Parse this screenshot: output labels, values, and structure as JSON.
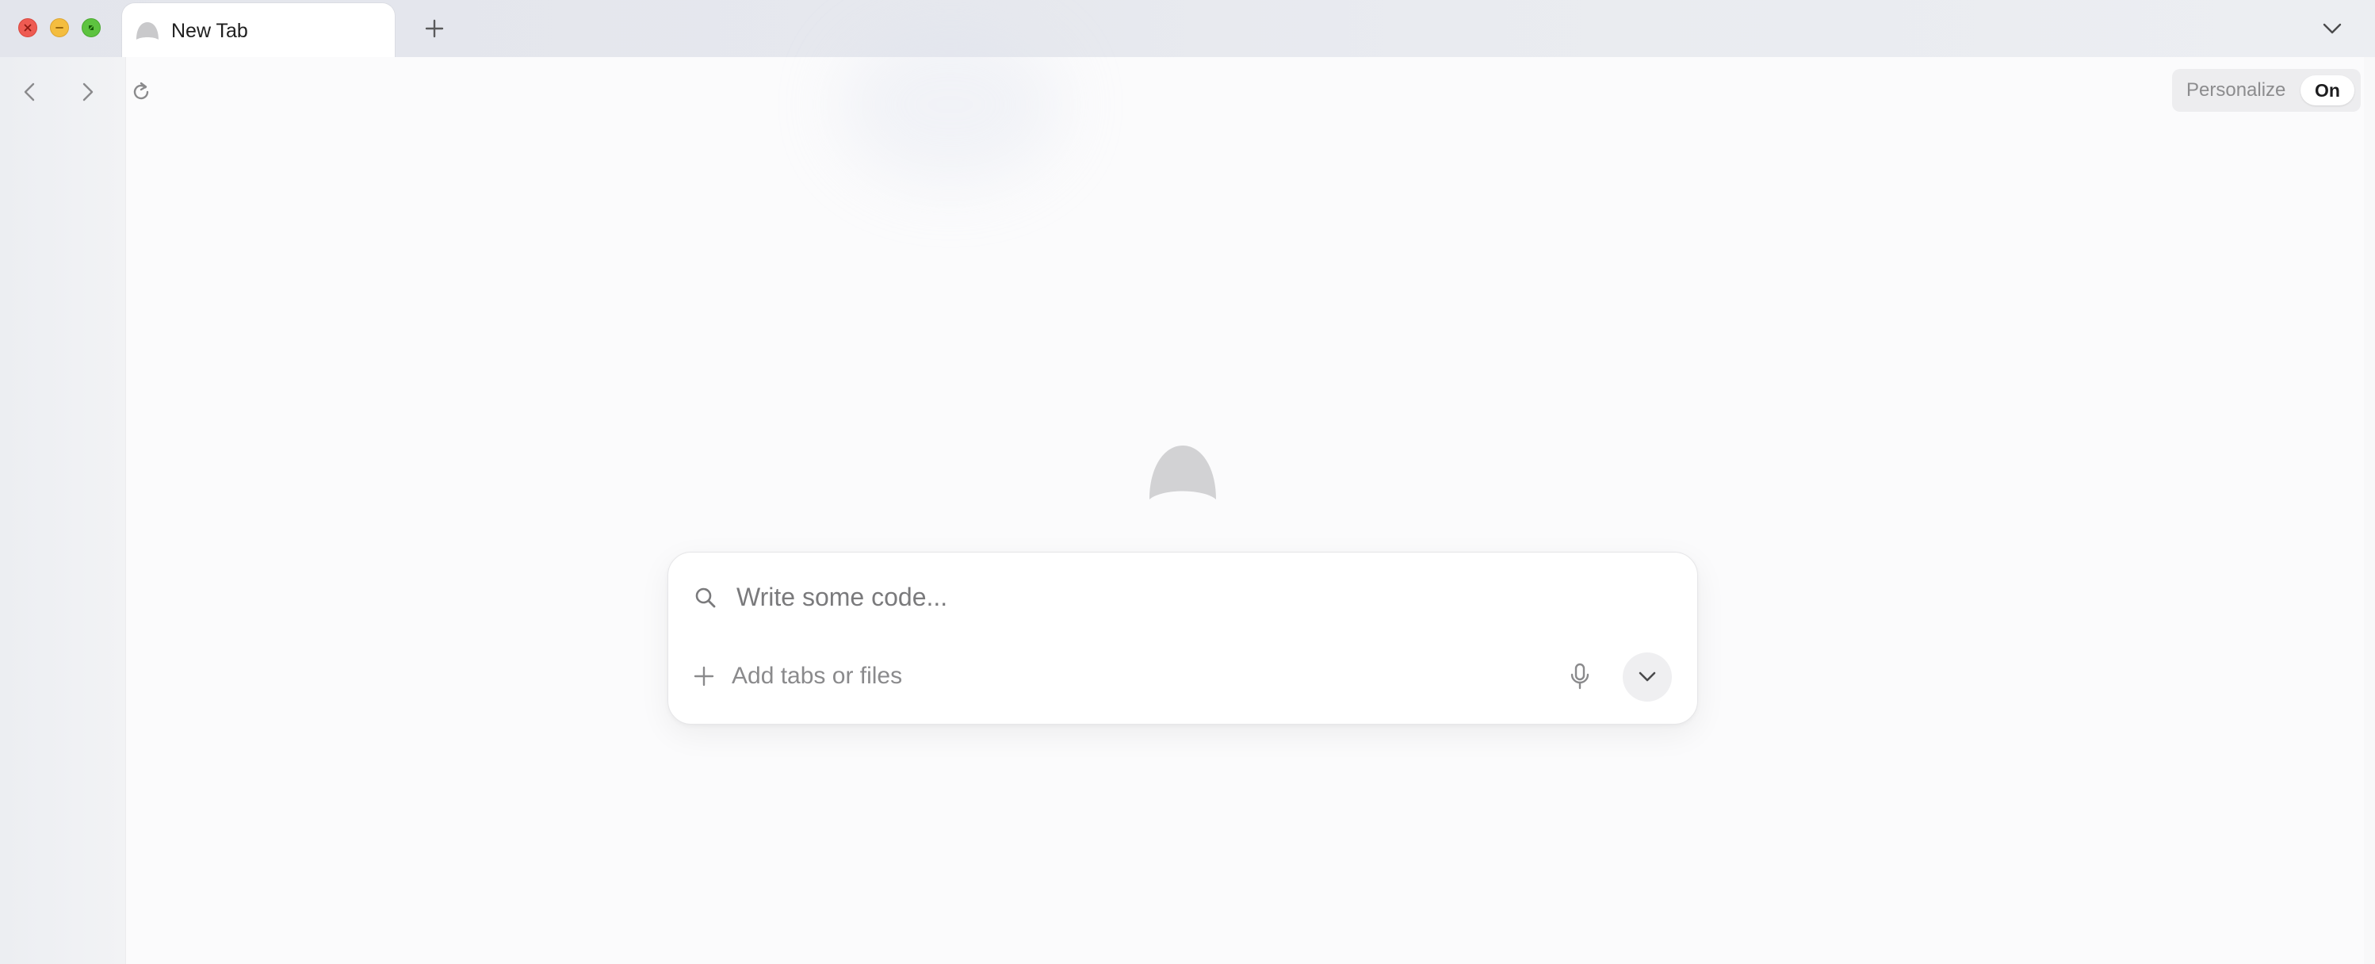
{
  "window": {
    "traffic_lights": [
      "close",
      "minimize",
      "zoom"
    ]
  },
  "tabs": [
    {
      "title": "New Tab",
      "icon": "dome-favicon-icon",
      "active": true
    }
  ],
  "tabstrip": {
    "new_tab_icon": "plus-icon",
    "tabs_menu_icon": "chevron-down-icon"
  },
  "toolbar": {
    "back_icon": "chevron-left-icon",
    "forward_icon": "chevron-right-icon",
    "reload_icon": "reload-icon",
    "personalize_label": "Personalize",
    "personalize_toggle": "On"
  },
  "search": {
    "placeholder": "Write some code...",
    "value": "",
    "add_label": "Add tabs or files",
    "mic_icon": "microphone-icon",
    "expand_icon": "chevron-down-icon"
  },
  "colors": {
    "close": "#ee5b52",
    "minimize": "#f4bd3f",
    "zoom": "#5dc33f",
    "logo": "#d2d2d4"
  }
}
